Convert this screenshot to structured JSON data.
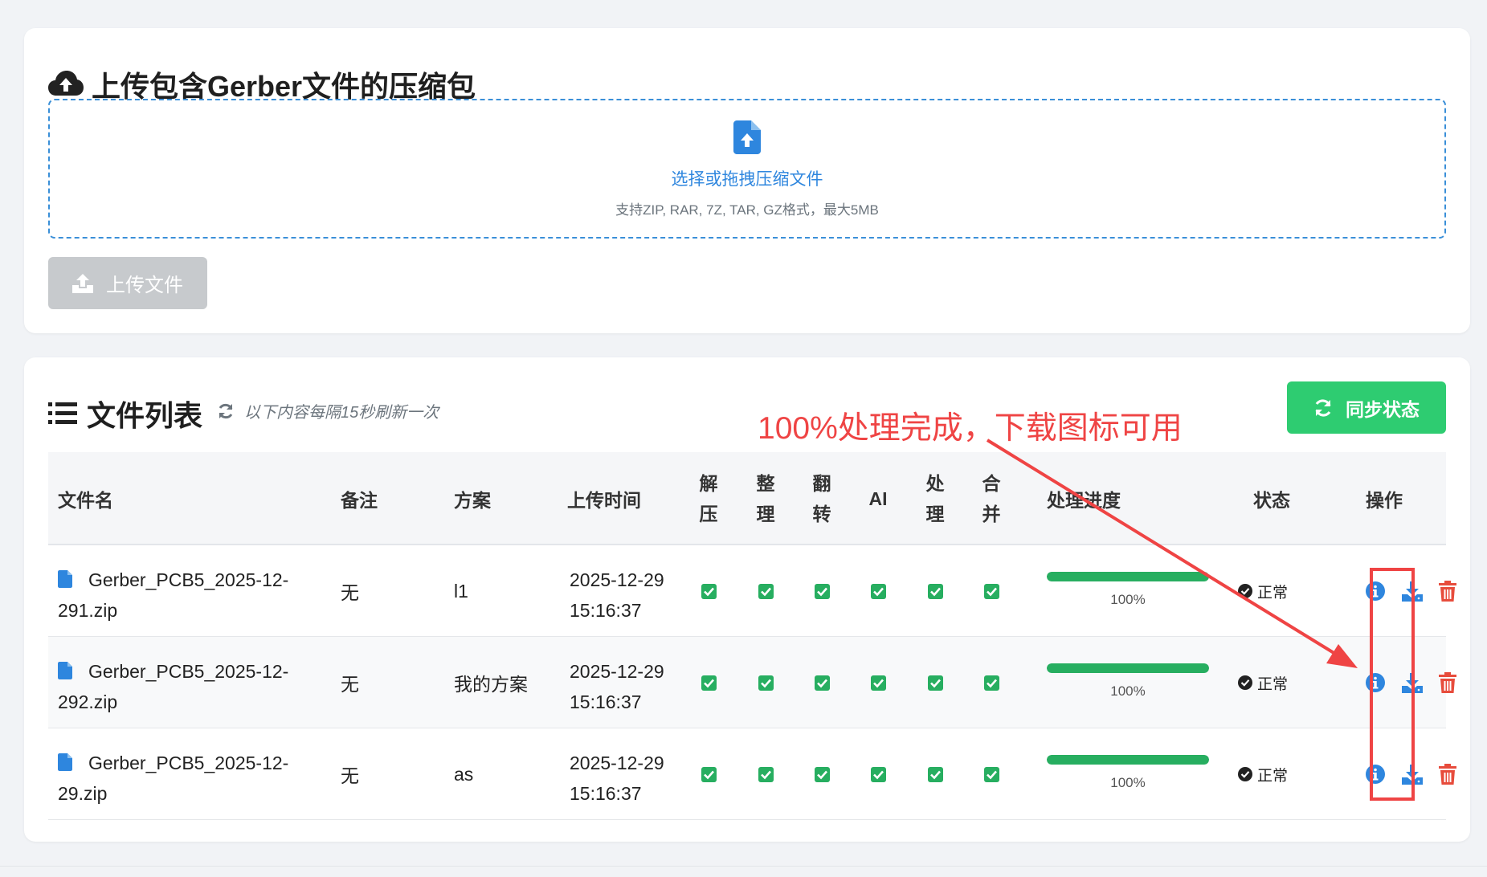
{
  "upload_card": {
    "title": "上传包含Gerber文件的压缩包",
    "dropzone_label": "选择或拖拽压缩文件",
    "dropzone_hint": "支持ZIP, RAR, 7Z, TAR, GZ格式，最大5MB",
    "upload_button": "上传文件"
  },
  "list_card": {
    "title": "文件列表",
    "refresh_note": "以下内容每隔15秒刷新一次",
    "sync_button": "同步状态",
    "columns": {
      "filename": "文件名",
      "remark": "备注",
      "plan": "方案",
      "upload_time": "上传时间",
      "unzip_1": "解",
      "unzip_2": "压",
      "organize_1": "整",
      "organize_2": "理",
      "flip_1": "翻",
      "flip_2": "转",
      "ai": "AI",
      "process_1": "处",
      "process_2": "理",
      "merge_1": "合",
      "merge_2": "并",
      "progress": "处理进度",
      "status": "状态",
      "actions": "操作"
    },
    "rows": [
      {
        "filename_1": "Gerber_PCB5_2025-12-",
        "filename_2": "291.zip",
        "remark": "无",
        "plan": "l1",
        "date": "2025-12-29",
        "time": "15:16:37",
        "progress": 1.0,
        "progress_text": "100%",
        "status": "正常"
      },
      {
        "filename_1": "Gerber_PCB5_2025-12-",
        "filename_2": "292.zip",
        "remark": "无",
        "plan": "我的方案",
        "date": "2025-12-29",
        "time": "15:16:37",
        "progress": 1.0,
        "progress_text": "100%",
        "status": "正常"
      },
      {
        "filename_1": "Gerber_PCB5_2025-12-",
        "filename_2": "29.zip",
        "remark": "无",
        "plan": "as",
        "date": "2025-12-29",
        "time": "15:16:37",
        "progress": 1.0,
        "progress_text": "100%",
        "status": "正常"
      }
    ]
  },
  "annotation": {
    "text": "100%处理完成，下载图标可用",
    "color": "#ef4444"
  },
  "colors": {
    "accent_blue": "#2e86de",
    "success_green": "#2ecc71",
    "progress_green": "#27ae60",
    "danger_red": "#e74c3c",
    "disabled_gray": "#c7cacd"
  },
  "icons": {
    "upload_card_title": "cloud-upload-icon",
    "dropzone": "file-upload-icon",
    "upload_button": "upload-icon",
    "list_card_title": "list-icon",
    "refresh_note": "refresh-icon",
    "sync_button": "sync-icon",
    "filename": "file-icon",
    "step_done": "checkbox-checked-icon",
    "status": "check-circle-icon",
    "info": "info-icon",
    "download": "download-icon",
    "delete": "trash-icon"
  }
}
